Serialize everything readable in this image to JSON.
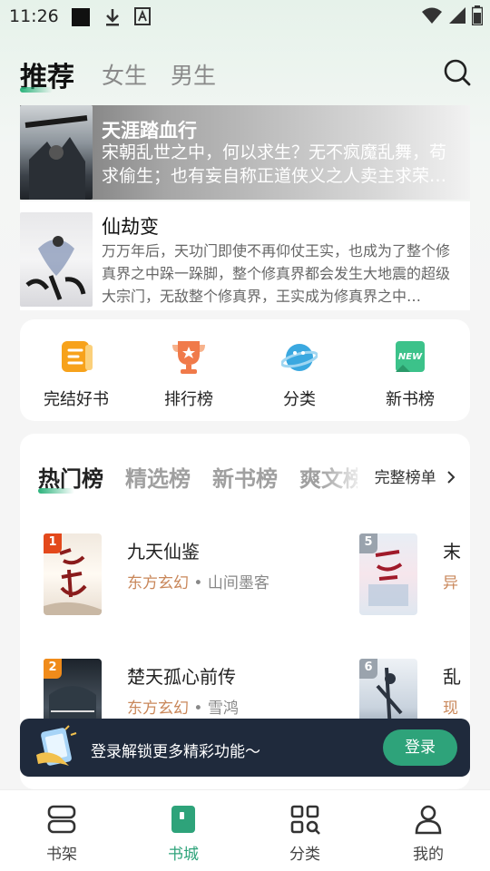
{
  "status_bar": {
    "time": "11:26"
  },
  "top_tabs": [
    {
      "label": "推荐",
      "active": true
    },
    {
      "label": "女生",
      "active": false
    },
    {
      "label": "男生",
      "active": false
    }
  ],
  "featured": [
    {
      "title": "天涯踏血行",
      "description": "宋朝乱世之中，何以求生？无不疯魔乱舞，苟求偷生；也有妄自称正道侠义之人卖主求荣…"
    },
    {
      "title": "仙劫变",
      "description": "万万年后，天功门即使不再仰仗王实，也成为了整个修真界之中跺一跺脚，整个修真界都会发生大地震的超级大宗门，无敌整个修真界，王实成为修真界之中…"
    }
  ],
  "quick_links": [
    {
      "label": "完结好书",
      "icon": "finished-books-icon",
      "color": "#f7a21b"
    },
    {
      "label": "排行榜",
      "icon": "trophy-icon",
      "color": "#f07a4a"
    },
    {
      "label": "分类",
      "icon": "planet-icon",
      "color": "#3aa8e0"
    },
    {
      "label": "新书榜",
      "icon": "new-badge-icon",
      "color": "#3cc28a",
      "badge": "NEW"
    }
  ],
  "ranking": {
    "tabs": [
      "热门榜",
      "精选榜",
      "新书榜",
      "爽文榜"
    ],
    "active_tab": "热门榜",
    "full_list_label": "完整榜单",
    "books": [
      {
        "rank": "1",
        "title": "九天仙鉴",
        "genre": "东方玄幻",
        "author": "山间墨客"
      },
      {
        "rank": "5",
        "title": "末",
        "genre": "异",
        "author": ""
      },
      {
        "rank": "2",
        "title": "楚天孤心前传",
        "genre": "东方玄幻",
        "author": "雪鸿"
      },
      {
        "rank": "6",
        "title": "乱",
        "genre": "现",
        "author": ""
      }
    ],
    "meta_separator": "•"
  },
  "login_banner": {
    "text": "登录解锁更多精彩功能～",
    "button_label": "登录"
  },
  "bottom_nav": [
    {
      "label": "书架",
      "active": false
    },
    {
      "label": "书城",
      "active": true
    },
    {
      "label": "分类",
      "active": false
    },
    {
      "label": "我的",
      "active": false
    }
  ],
  "colors": {
    "accent": "#2ea37a",
    "genre": "#c9875a",
    "banner_bg": "#1f2a3c"
  }
}
